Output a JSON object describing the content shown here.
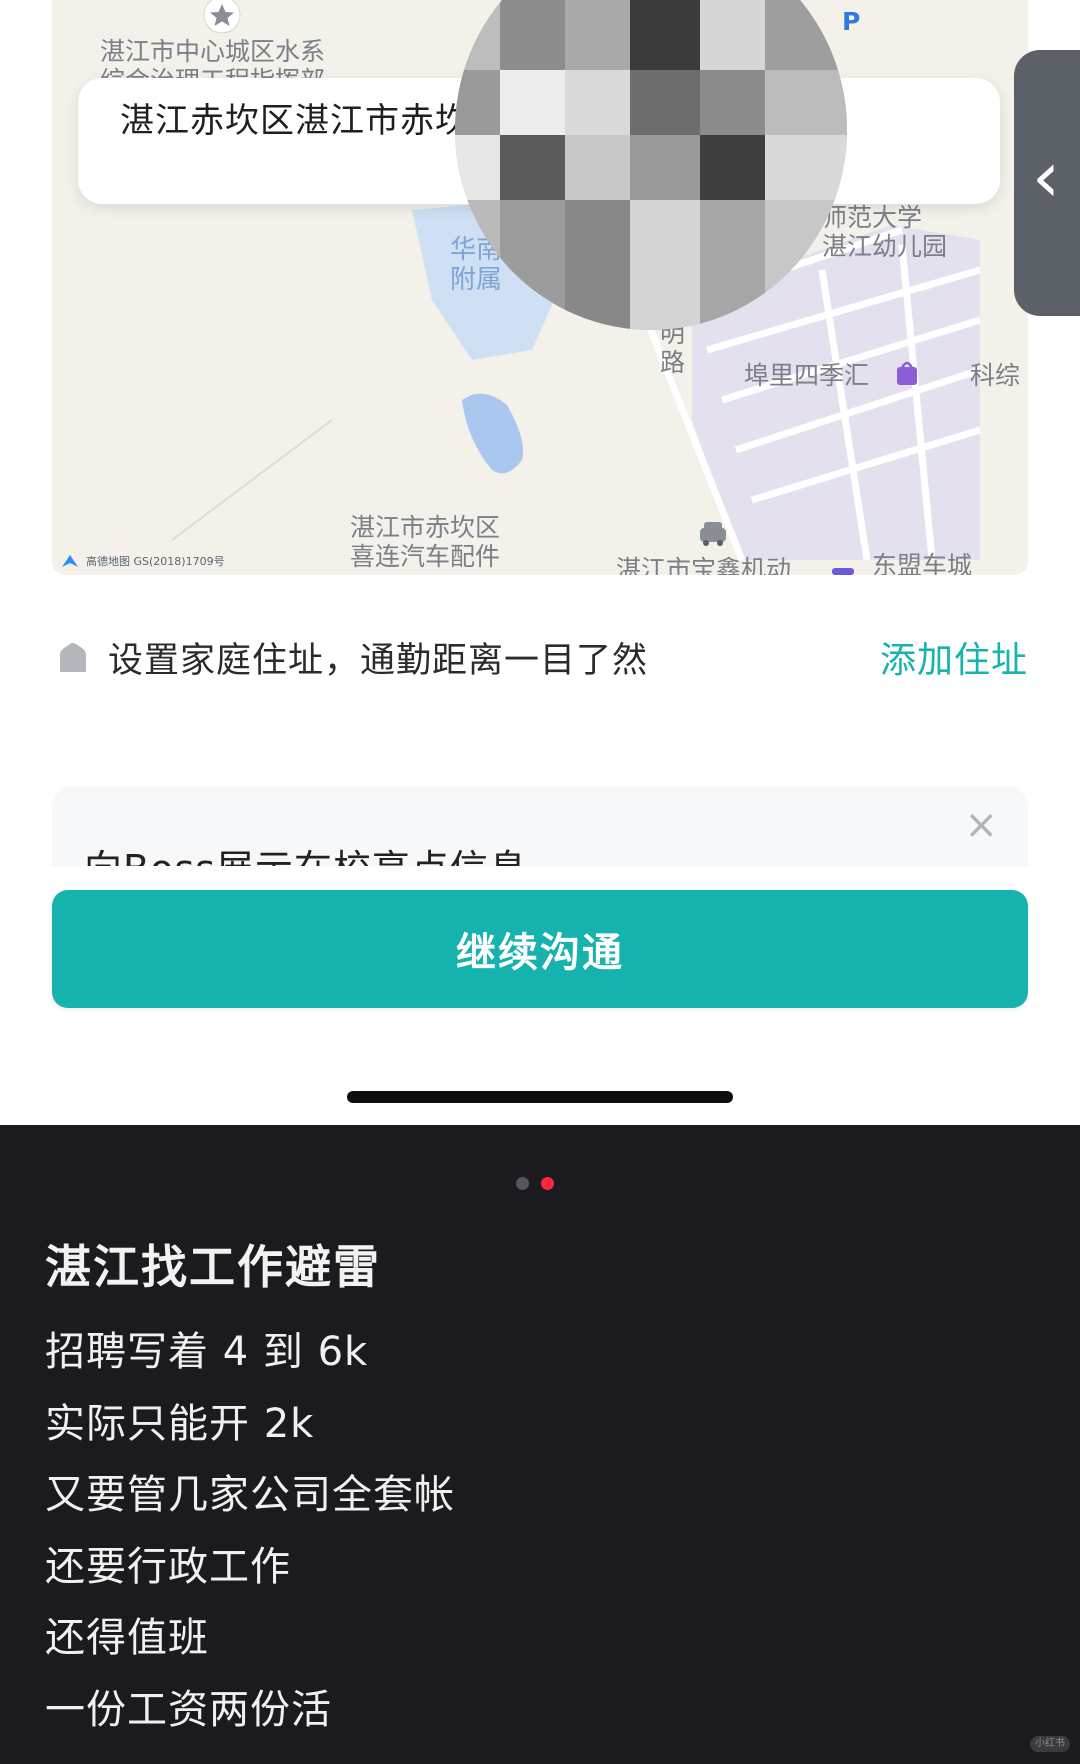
{
  "map": {
    "labels": {
      "water_system": "湛江市中心城区水系\n综合治理工程指挥部",
      "huanan": "华南\n附属",
      "normal_univ": "师范大学\n湛江幼儿园",
      "road_ming": "明\n路",
      "bufu": "埠里四季汇",
      "keji": "科综",
      "chikan_car": "湛江市赤坎区\n喜连汽车配件",
      "motor": "湛江市宝鑫机动",
      "dongmeng": "东盟车城",
      "parking": "P"
    },
    "attribution": "高德地图  GS(2018)1709号"
  },
  "address_card": {
    "text": "湛江赤坎区湛江市赤坎区源珠路"
  },
  "home_row": {
    "text": "设置家庭住址，通勤距离一目了然",
    "add_link": "添加住址"
  },
  "boss_card": {
    "title": "向Boss展示在校亮点信息",
    "close_glyph": "×"
  },
  "continue_button": {
    "label": "继续沟通"
  },
  "caption": {
    "pager": {
      "count": 2,
      "active_index": 1
    },
    "title": "湛江找工作避雷",
    "lines": [
      "招聘写着 4 到 6k",
      "实际只能开 2k",
      "又要管几家公司全套帐",
      "还要行政工作",
      "还得值班",
      "一份工资两份活"
    ]
  },
  "watermark": "小红书",
  "colors": {
    "accent_teal": "#16b2ad",
    "caption_bg": "#1b1b1f",
    "pager_active": "#ff2442",
    "map_bg": "#f3f1ea"
  }
}
